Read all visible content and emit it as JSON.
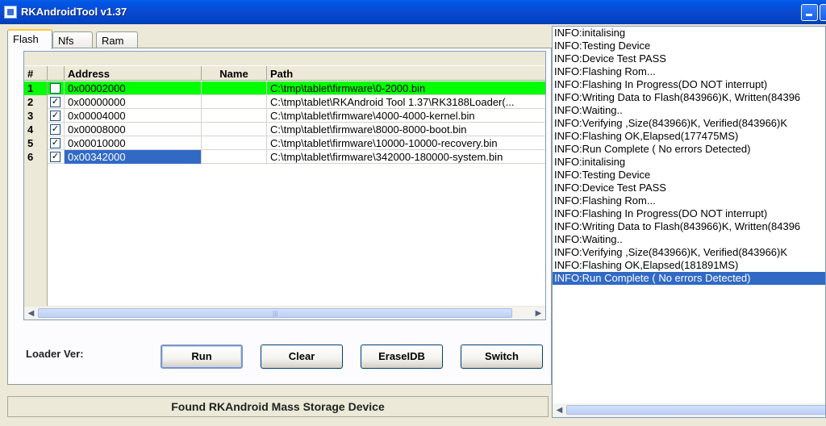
{
  "window": {
    "title": "RKAndroidTool v1.37"
  },
  "tabs": [
    {
      "label": "Flash",
      "active": true
    },
    {
      "label": "Nfs",
      "active": false
    },
    {
      "label": "Ram",
      "active": false
    }
  ],
  "table": {
    "headers": {
      "num": "#",
      "address": "Address",
      "name": "Name",
      "path": "Path"
    },
    "rows": [
      {
        "num": "1",
        "checked": false,
        "address": "0x00002000",
        "name": "",
        "path": "C:\\tmp\\tablet\\firmware\\0-2000.bin",
        "highlight": "green"
      },
      {
        "num": "2",
        "checked": true,
        "address": "0x00000000",
        "name": "",
        "path": "C:\\tmp\\tablet\\RKAndroid Tool 1.37\\RK3188Loader(..."
      },
      {
        "num": "3",
        "checked": true,
        "address": "0x00004000",
        "name": "",
        "path": "C:\\tmp\\tablet\\firmware\\4000-4000-kernel.bin"
      },
      {
        "num": "4",
        "checked": true,
        "address": "0x00008000",
        "name": "",
        "path": "C:\\tmp\\tablet\\firmware\\8000-8000-boot.bin"
      },
      {
        "num": "5",
        "checked": true,
        "address": "0x00010000",
        "name": "",
        "path": "C:\\tmp\\tablet\\firmware\\10000-10000-recovery.bin"
      },
      {
        "num": "6",
        "checked": true,
        "address": "0x00342000",
        "name": "",
        "path": "C:\\tmp\\tablet\\firmware\\342000-180000-system.bin",
        "address_selected": true
      }
    ]
  },
  "loader_ver_label": "Loader Ver:",
  "buttons": {
    "run": "Run",
    "clear": "Clear",
    "erase_idb": "EraseIDB",
    "switch": "Switch"
  },
  "status": "Found RKAndroid Mass Storage Device",
  "log": [
    "INFO:initalising",
    "INFO:Testing Device",
    "INFO:Device Test PASS",
    "INFO:Flashing Rom...",
    "INFO:Flashing In Progress(DO NOT interrupt)",
    "INFO:Writing Data to Flash(843966)K, Written(84396",
    "INFO:Waiting..",
    "INFO:Verifying ,Size(843966)K, Verified(843966)K",
    "INFO:Flashing OK,Elapsed(177475MS)",
    "INFO:Run Complete ( No errors Detected)",
    "INFO:initalising",
    "INFO:Testing Device",
    "INFO:Device Test PASS",
    "INFO:Flashing Rom...",
    "INFO:Flashing In Progress(DO NOT interrupt)",
    "INFO:Writing Data to Flash(843966)K, Written(84396",
    "INFO:Waiting..",
    "INFO:Verifying ,Size(843966)K, Verified(843966)K",
    "INFO:Flashing OK,Elapsed(181891MS)",
    "INFO:Run Complete ( No errors Detected)"
  ],
  "log_selected_index": 19,
  "colors": {
    "title_bar": "#0b4ad0",
    "row_highlight": "#00ff00",
    "selection": "#316ac5"
  },
  "icons": {
    "app": "app-icon",
    "minimize": "minimize-icon",
    "maximize": "maximize-icon",
    "scroll_left": "arrow-left-icon",
    "scroll_right": "arrow-right-icon"
  }
}
